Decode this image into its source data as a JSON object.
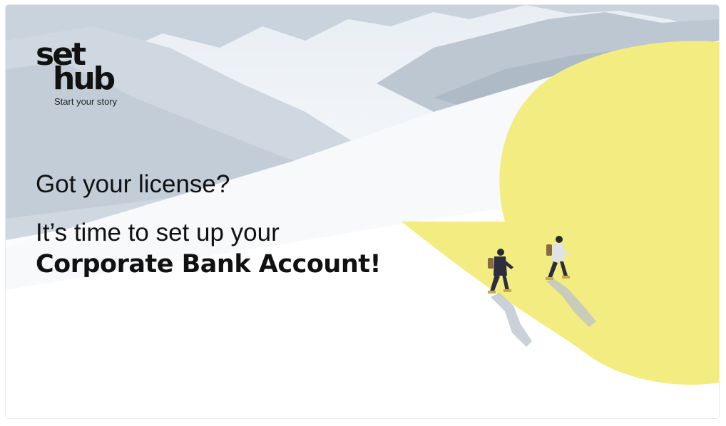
{
  "brand": {
    "logo_line1": "set",
    "logo_line2": "hub",
    "tagline": "Start your story",
    "accent_color": "#f3ec80"
  },
  "content": {
    "headline": "Got your license?",
    "subline": "It’s time to set up your",
    "subline_strong": "Corporate Bank Account!"
  }
}
